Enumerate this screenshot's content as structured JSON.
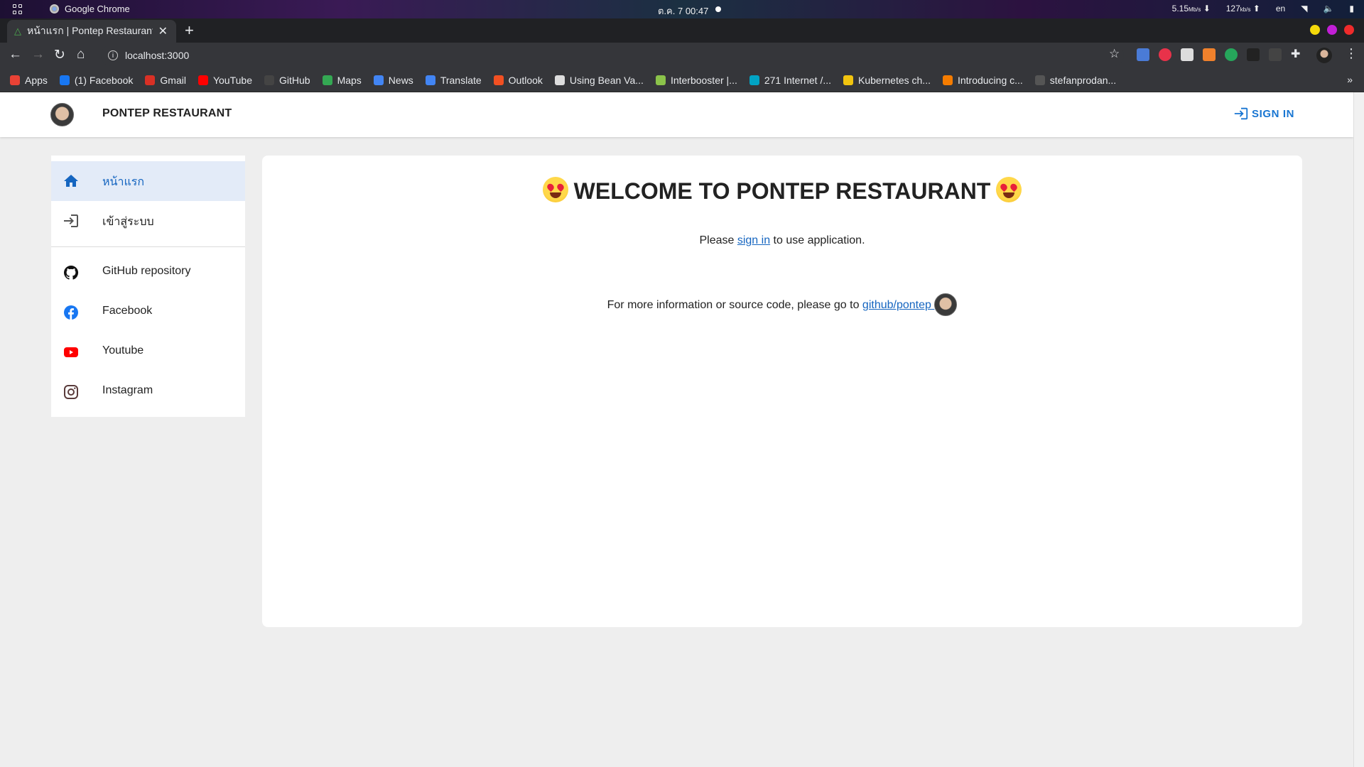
{
  "os": {
    "app_name": "Google Chrome",
    "clock": "ต.ค. 7  00:47",
    "net_down": "5.15",
    "net_down_unit": "Mb/s",
    "net_up": "127",
    "net_up_unit": "kb/s",
    "lang": "en"
  },
  "browser": {
    "tab_title": "หน้าแรก | Pontep Restaurant",
    "url": "localhost:3000",
    "bookmarks": [
      {
        "label": "Apps",
        "color": "#e94235"
      },
      {
        "label": "(1) Facebook",
        "color": "#1877f2"
      },
      {
        "label": "Gmail",
        "color": "#d93025"
      },
      {
        "label": "YouTube",
        "color": "#ff0000"
      },
      {
        "label": "GitHub",
        "color": "#444444"
      },
      {
        "label": "Maps",
        "color": "#34a853"
      },
      {
        "label": "News",
        "color": "#4285f4"
      },
      {
        "label": "Translate",
        "color": "#4285f4"
      },
      {
        "label": "Outlook",
        "color": "#f25022"
      },
      {
        "label": "Using Bean Va...",
        "color": "#dddddd"
      },
      {
        "label": "Interbooster |...",
        "color": "#8bc34a"
      },
      {
        "label": "271 Internet /...",
        "color": "#00a3c4"
      },
      {
        "label": "Kubernetes ch...",
        "color": "#f1c40f"
      },
      {
        "label": "Introducing c...",
        "color": "#f57c00"
      },
      {
        "label": "stefanprodan...",
        "color": "#555555"
      }
    ],
    "bookmarks_more": "»"
  },
  "app": {
    "brand": "PONTEP RESTAURANT",
    "signin_label": "SIGN IN",
    "accent": "#1976d2"
  },
  "drawer": {
    "items": [
      {
        "label": "หน้าแรก",
        "icon": "home-icon"
      },
      {
        "label": "เข้าสู่ระบบ",
        "icon": "login-icon"
      },
      {
        "label": "GitHub repository",
        "icon": "github-icon"
      },
      {
        "label": "Facebook",
        "icon": "facebook-icon"
      },
      {
        "label": "Youtube",
        "icon": "youtube-icon"
      },
      {
        "label": "Instagram",
        "icon": "instagram-icon"
      }
    ]
  },
  "main": {
    "welcome": "WELCOME TO PONTEP RESTAURANT",
    "line1_before": "Please ",
    "line1_link": "sign in",
    "line1_after": " to use application.",
    "line2_before": "For more information or source code, please go to ",
    "line2_link": "github/pontep"
  }
}
